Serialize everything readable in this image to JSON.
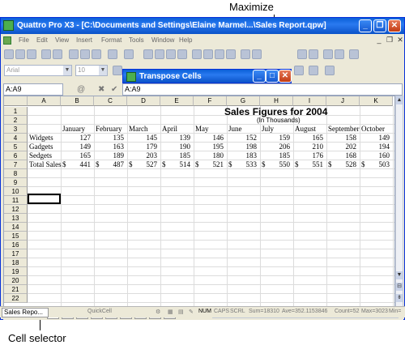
{
  "annotations": {
    "maximize": "Maximize",
    "cell_selector": "Cell selector"
  },
  "window": {
    "title": "Quattro Pro X3 - [C:\\Documents and Settings\\Elaine Marmel...\\Sales Report.qpw]"
  },
  "menu": [
    "File",
    "Edit",
    "View",
    "Insert",
    "Format",
    "Tools",
    "Window",
    "Help"
  ],
  "font_combo": {
    "font": "Arial",
    "size": "10"
  },
  "dialog": {
    "title": "Transpose Cells"
  },
  "formula_bar": {
    "name_box": "A:A9",
    "formula": "A:A9"
  },
  "columns": [
    "A",
    "B",
    "C",
    "D",
    "E",
    "F",
    "G",
    "H",
    "I",
    "J",
    "K"
  ],
  "rows": [
    "1",
    "2",
    "3",
    "4",
    "5",
    "6",
    "7",
    "8",
    "9",
    "10",
    "11",
    "12",
    "13",
    "14",
    "15",
    "16",
    "17",
    "18",
    "19",
    "20",
    "21",
    "22"
  ],
  "sheet": {
    "title": "Sales Figures for 2004",
    "subtitle": "(In Thousands)",
    "months": [
      "January",
      "February",
      "March",
      "April",
      "May",
      "June",
      "July",
      "August",
      "September",
      "October"
    ],
    "rows": [
      {
        "label": "Widgets",
        "values": [
          "127",
          "135",
          "145",
          "139",
          "146",
          "152",
          "159",
          "165",
          "158",
          "149"
        ]
      },
      {
        "label": "Gadgets",
        "values": [
          "149",
          "163",
          "179",
          "190",
          "195",
          "198",
          "206",
          "210",
          "202",
          "194"
        ]
      },
      {
        "label": "Sedgets",
        "values": [
          "165",
          "189",
          "203",
          "185",
          "180",
          "183",
          "185",
          "176",
          "168",
          "160"
        ]
      },
      {
        "label": "Total Sales",
        "currency": "$",
        "values": [
          "441",
          "487",
          "527",
          "514",
          "521",
          "533",
          "550",
          "551",
          "528",
          "503"
        ]
      }
    ]
  },
  "sheet_tabs": [
    "A",
    "B",
    "C",
    "D",
    "E",
    "F",
    "G",
    "H",
    "I"
  ],
  "statusbar": {
    "task": "Sales Repo...",
    "quickcell": "QuickCell",
    "num": "NUM",
    "caps": "CAPS",
    "scrl": "SCRL",
    "sum": "Sum=18310",
    "ave": "Ave=352.1153846",
    "count": "Count=52",
    "max": "Max=3023",
    "min": "Min="
  }
}
